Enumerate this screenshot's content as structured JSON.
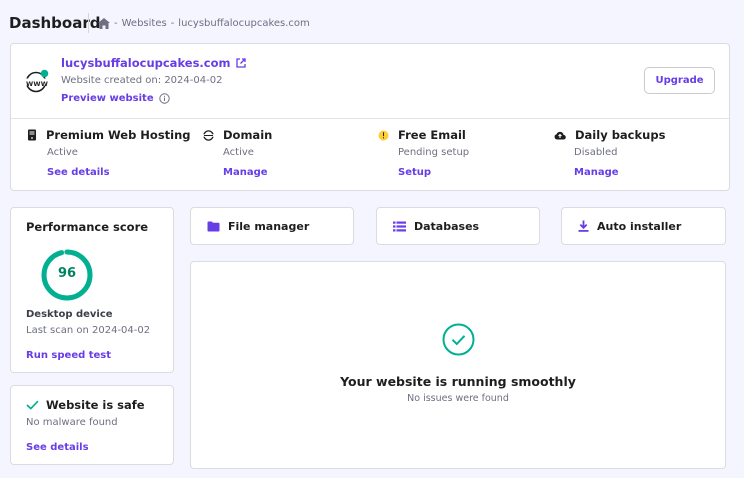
{
  "header": {
    "title": "Dashboard",
    "breadcrumb": [
      "Websites",
      "lucysbuffalocupcakes.com"
    ],
    "separator": "-"
  },
  "website": {
    "domain": "lucysbuffalocupcakes.com",
    "created": "Website created on: 2024-04-02",
    "preview_label": "Preview website",
    "upgrade_label": "Upgrade",
    "logo_text": "WWW"
  },
  "services": [
    {
      "title": "Premium Web Hosting",
      "status": "Active",
      "action": "See details",
      "icon": "server-icon"
    },
    {
      "title": "Domain",
      "status": "Active",
      "action": "Manage",
      "icon": "globe-icon"
    },
    {
      "title": "Free Email",
      "status": "Pending setup",
      "action": "Setup",
      "icon": "warning-dot-icon"
    },
    {
      "title": "Daily backups",
      "status": "Disabled",
      "action": "Manage",
      "icon": "cloud-upload-icon"
    }
  ],
  "performance": {
    "title": "Performance score",
    "score": "96",
    "score_value": 96,
    "device": "Desktop device",
    "last_scan": "Last scan on 2024-04-02",
    "action": "Run speed test"
  },
  "security": {
    "title": "Website is safe",
    "status": "No malware found",
    "action": "See details"
  },
  "quick_actions": [
    {
      "label": "File manager",
      "icon": "folder-icon"
    },
    {
      "label": "Databases",
      "icon": "database-icon"
    },
    {
      "label": "Auto installer",
      "icon": "download-icon"
    }
  ],
  "status_panel": {
    "title": "Your website is running smoothly",
    "subtitle": "No issues were found"
  },
  "colors": {
    "accent": "#673de6",
    "success": "#00b090",
    "warning": "#ffcd35",
    "background": "#f4f5ff"
  }
}
